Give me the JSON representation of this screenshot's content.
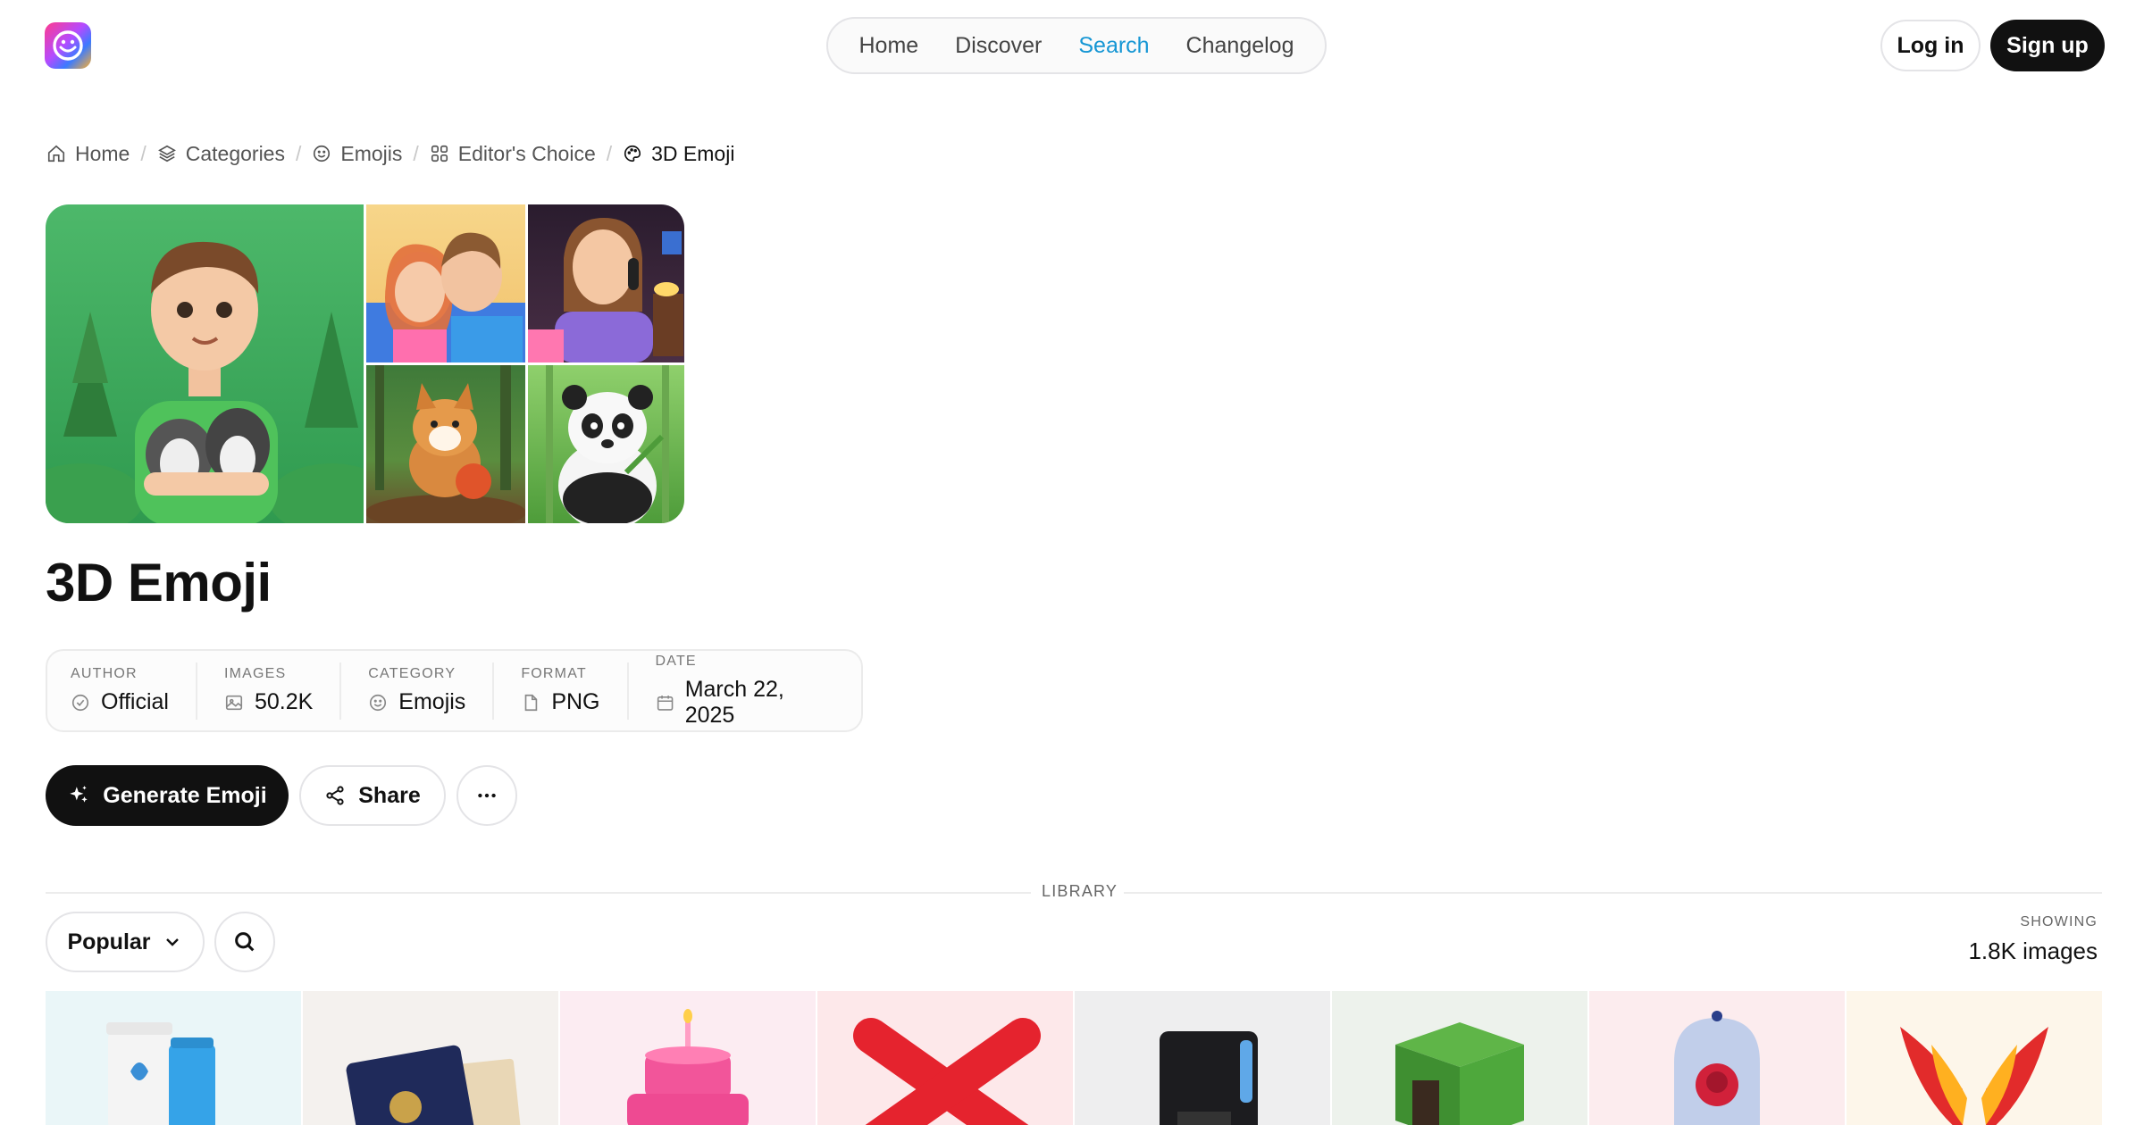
{
  "nav": {
    "links": [
      "Home",
      "Discover",
      "Search",
      "Changelog"
    ],
    "active": "Search",
    "login": "Log in",
    "signup": "Sign up"
  },
  "breadcrumb": [
    {
      "label": "Home",
      "icon": "home-icon"
    },
    {
      "label": "Categories",
      "icon": "layers-icon"
    },
    {
      "label": "Emojis",
      "icon": "smiley-icon"
    },
    {
      "label": "Editor's Choice",
      "icon": "grid-icon"
    },
    {
      "label": "3D Emoji",
      "icon": "palette-icon"
    }
  ],
  "page": {
    "title": "3D Emoji"
  },
  "meta": [
    {
      "label": "AUTHOR",
      "value": "Official",
      "icon": "check-circle-icon"
    },
    {
      "label": "IMAGES",
      "value": "50.2K",
      "icon": "image-icon"
    },
    {
      "label": "CATEGORY",
      "value": "Emojis",
      "icon": "smiley-icon"
    },
    {
      "label": "FORMAT",
      "value": "PNG",
      "icon": "file-icon"
    },
    {
      "label": "DATE",
      "value": "March 22, 2025",
      "icon": "calendar-icon"
    }
  ],
  "actions": {
    "generate": "Generate Emoji",
    "share": "Share"
  },
  "library": {
    "divider_label": "LIBRARY",
    "sort": "Popular",
    "showing_label": "SHOWING",
    "showing_value": "1.8K images"
  },
  "colors": {
    "accent": "#1596d4",
    "primary": "#111111",
    "border": "#e4e4e7"
  }
}
